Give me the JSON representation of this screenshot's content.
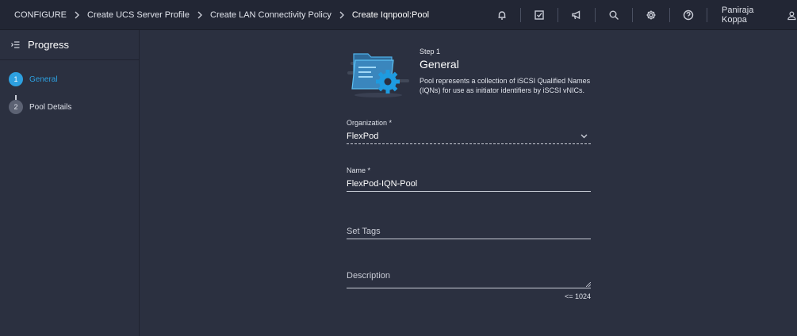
{
  "breadcrumb": [
    {
      "label": "CONFIGURE"
    },
    {
      "label": "Create UCS Server Profile"
    },
    {
      "label": "Create LAN Connectivity Policy"
    },
    {
      "label": "Create Iqnpool:Pool"
    }
  ],
  "toolbar": {
    "icons": [
      "bell-icon",
      "task-check-icon",
      "megaphone-icon",
      "search-icon",
      "gear-icon",
      "help-icon"
    ],
    "user_name": "Paniraja Koppa"
  },
  "sidebar": {
    "title": "Progress",
    "steps": [
      {
        "number": "1",
        "label": "General",
        "state": "active"
      },
      {
        "number": "2",
        "label": "Pool Details",
        "state": "inactive"
      }
    ]
  },
  "form": {
    "step_label": "Step 1",
    "title": "General",
    "description": "Pool represents a collection of iSCSI Qualified Names (IQNs) for use as initiator identifiers by iSCSI vNICs.",
    "organization": {
      "label": "Organization *",
      "value": "FlexPod"
    },
    "name": {
      "label": "Name *",
      "value": "FlexPod-IQN-Pool"
    },
    "tags": {
      "placeholder": "Set Tags",
      "value": ""
    },
    "description_field": {
      "placeholder": "Description",
      "value": "",
      "limit": "<= 1024"
    }
  },
  "colors": {
    "accent": "#2da0e0",
    "background": "#2b3040",
    "topbar": "#222634"
  }
}
